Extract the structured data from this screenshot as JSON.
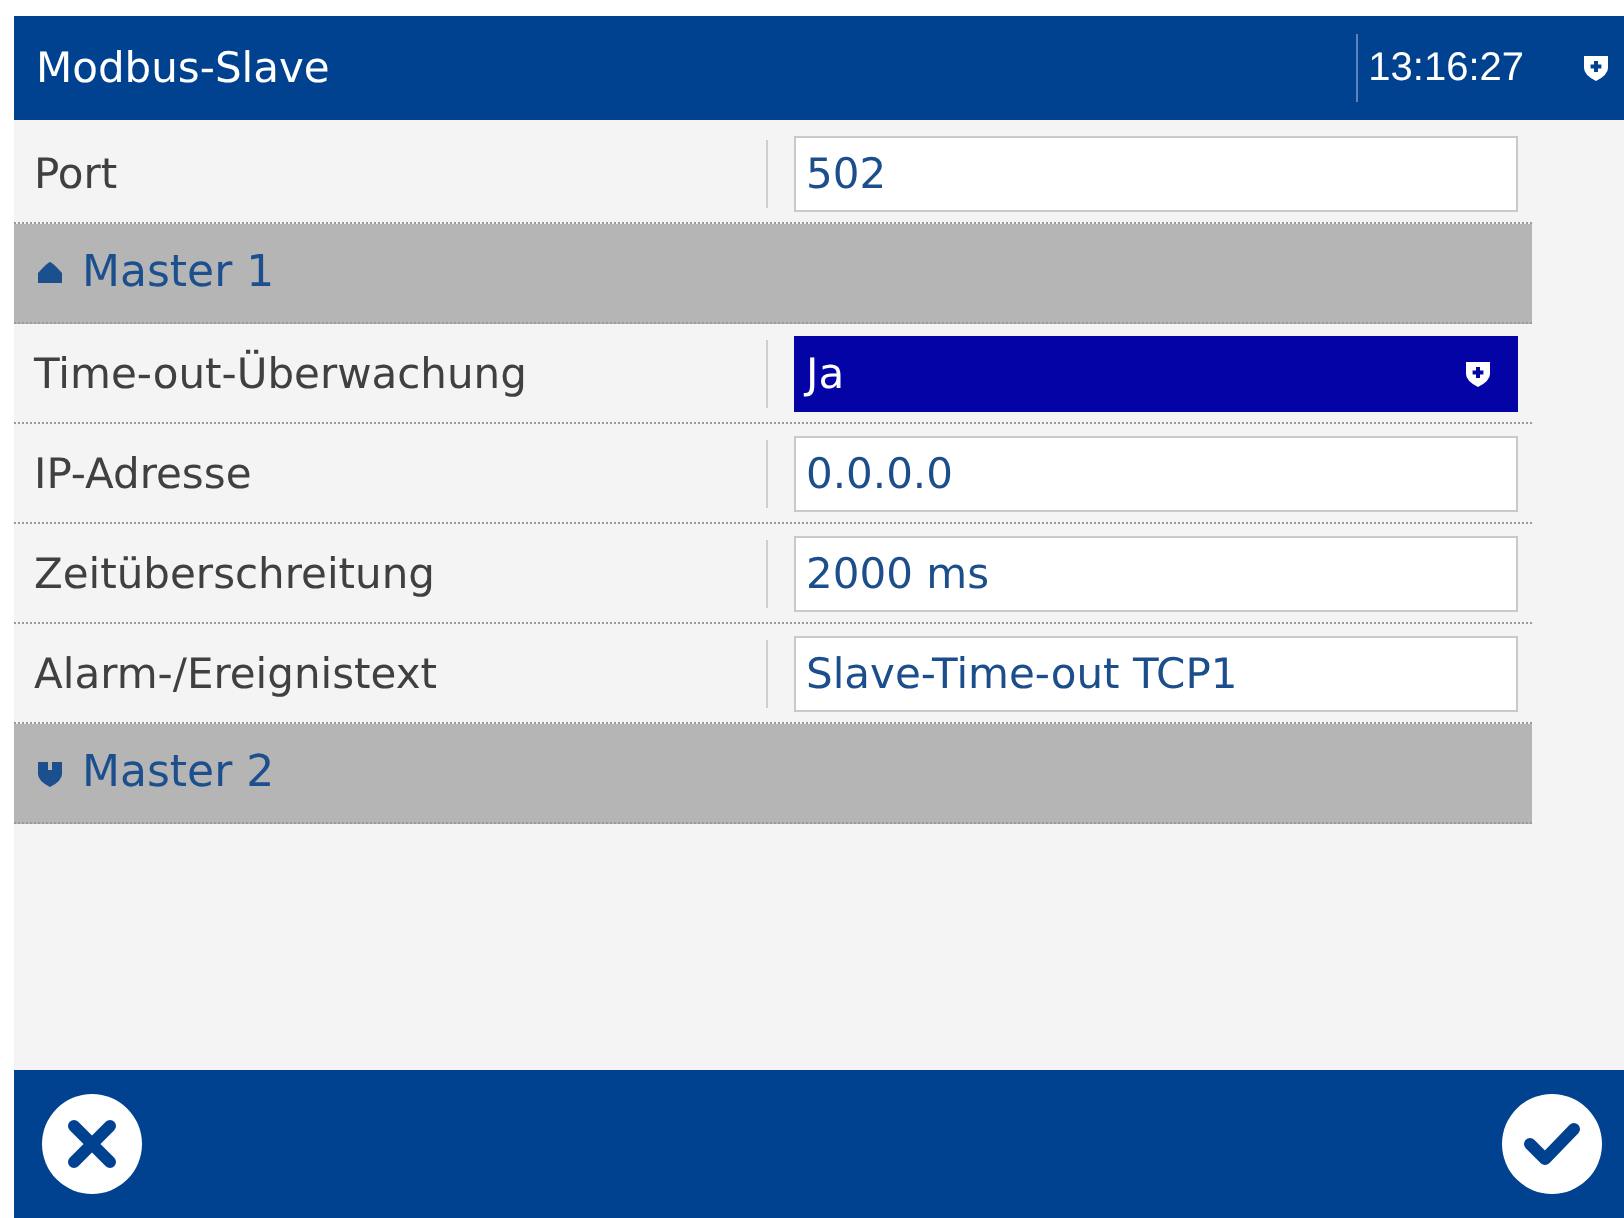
{
  "header": {
    "title": "Modbus-Slave",
    "time": "13:16:27"
  },
  "items": [
    {
      "kind": "field",
      "label": "Port",
      "value": "502",
      "selected": false
    },
    {
      "kind": "section",
      "label": "Master 1",
      "expanded": true,
      "selected": false
    },
    {
      "kind": "dropdown",
      "label": "Time-out-Überwachung",
      "value": "Ja",
      "selected": true
    },
    {
      "kind": "field",
      "label": "IP-Adresse",
      "value": "0.0.0.0",
      "selected": false
    },
    {
      "kind": "field",
      "label": "Zeitüberschreitung",
      "value": "2000 ms",
      "selected": false
    },
    {
      "kind": "field",
      "label": "Alarm-/Ereignistext",
      "value": "Slave-Time-out TCP1",
      "selected": false
    },
    {
      "kind": "section",
      "label": "Master 2",
      "expanded": false,
      "selected": false
    }
  ]
}
